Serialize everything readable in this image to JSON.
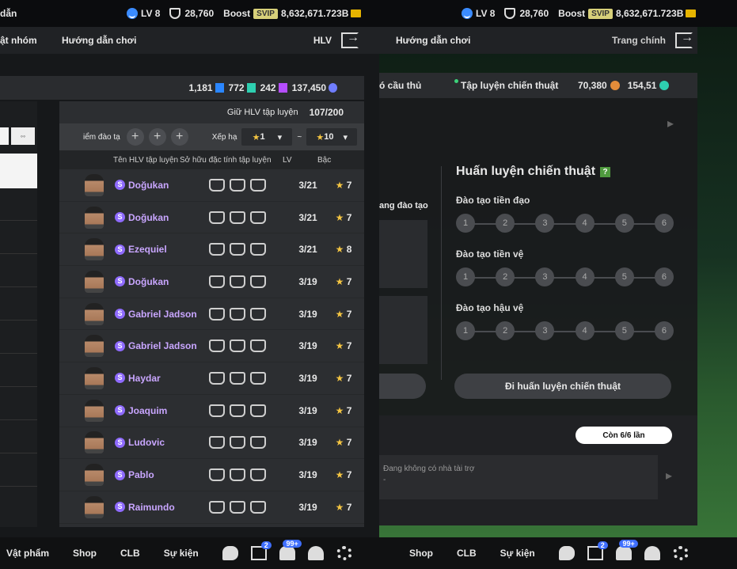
{
  "left": {
    "topbar": {
      "title": "dẫn",
      "lv": "LV 8",
      "points": "28,760",
      "boost": "Boost",
      "svip": "SVIP",
      "coins": "8,632,671.723B"
    },
    "nav": {
      "group": "ật nhóm",
      "guide": "Hướng dẫn chơi",
      "hlv": "HLV"
    },
    "resources": [
      {
        "value": "1,181",
        "color": "#2a86ff"
      },
      {
        "value": "772",
        "color": "#2ecfb0"
      },
      {
        "value": "242",
        "color": "#b54dff"
      },
      {
        "value": "137,450",
        "color": "#6f7dff"
      }
    ],
    "table": {
      "keep_label": "Giữ HLV tập luyện",
      "keep_value": "107/200",
      "filter_label": "iểm đào tạ",
      "sort_label": "Xếp hạ",
      "sort_from": "1",
      "sort_sep": "~",
      "sort_to": "10",
      "headers": {
        "name": "Tên HLV tập luyện",
        "traits": "Sở hữu đặc tính tập luyện",
        "lv": "LV",
        "rank": "Bậc"
      },
      "rows": [
        {
          "name": "Doğukan",
          "lv": "3/21",
          "rank": "7"
        },
        {
          "name": "Doğukan",
          "lv": "3/21",
          "rank": "7"
        },
        {
          "name": "Ezequiel",
          "lv": "3/21",
          "rank": "8"
        },
        {
          "name": "Doğukan",
          "lv": "3/19",
          "rank": "7"
        },
        {
          "name": "Gabriel Jadson",
          "lv": "3/19",
          "rank": "7"
        },
        {
          "name": "Gabriel Jadson",
          "lv": "3/19",
          "rank": "7"
        },
        {
          "name": "Haydar",
          "lv": "3/19",
          "rank": "7"
        },
        {
          "name": "Joaquim",
          "lv": "3/19",
          "rank": "7"
        },
        {
          "name": "Ludovic",
          "lv": "3/19",
          "rank": "7"
        },
        {
          "name": "Pablo",
          "lv": "3/19",
          "rank": "7"
        },
        {
          "name": "Raimundo",
          "lv": "3/19",
          "rank": "7"
        }
      ],
      "s_badge": "S"
    },
    "bottom": {
      "items": [
        "Vật phẩm",
        "Shop",
        "CLB",
        "Sự kiện"
      ],
      "badge1": "2",
      "badge2": "99+"
    }
  },
  "right": {
    "topbar": {
      "lv": "LV 8",
      "points": "28,760",
      "boost": "Boost",
      "svip": "SVIP",
      "coins": "8,632,671.723B"
    },
    "nav": {
      "guide": "Hướng dẫn chơi",
      "home": "Trang chính"
    },
    "tabs": {
      "players": "ó cầu thủ",
      "tactics": "Tập luyện chiến thuật",
      "res1": "70,380",
      "res2": "154,51"
    },
    "side_label": "ang đào tạo",
    "training": {
      "title": "Huấn luyện chiến thuật",
      "help": "?",
      "groups": [
        {
          "label": "Đào tạo tiền đạo",
          "steps": [
            "1",
            "2",
            "3",
            "4",
            "5",
            "6"
          ]
        },
        {
          "label": "Đào tạo tiền vệ",
          "steps": [
            "1",
            "2",
            "3",
            "4",
            "5",
            "6"
          ]
        },
        {
          "label": "Đào tạo hậu vệ",
          "steps": [
            "1",
            "2",
            "3",
            "4",
            "5",
            "6"
          ]
        }
      ],
      "button": "Đi huấn luyện chiến thuật"
    },
    "remaining": "Còn 6/6 lần",
    "sponsor": {
      "text": "Đang không có nhà tài trợ",
      "dash": "-"
    },
    "bottom": {
      "items": [
        "Shop",
        "CLB",
        "Sự kiện"
      ],
      "badge1": "2",
      "badge2": "99+"
    }
  }
}
